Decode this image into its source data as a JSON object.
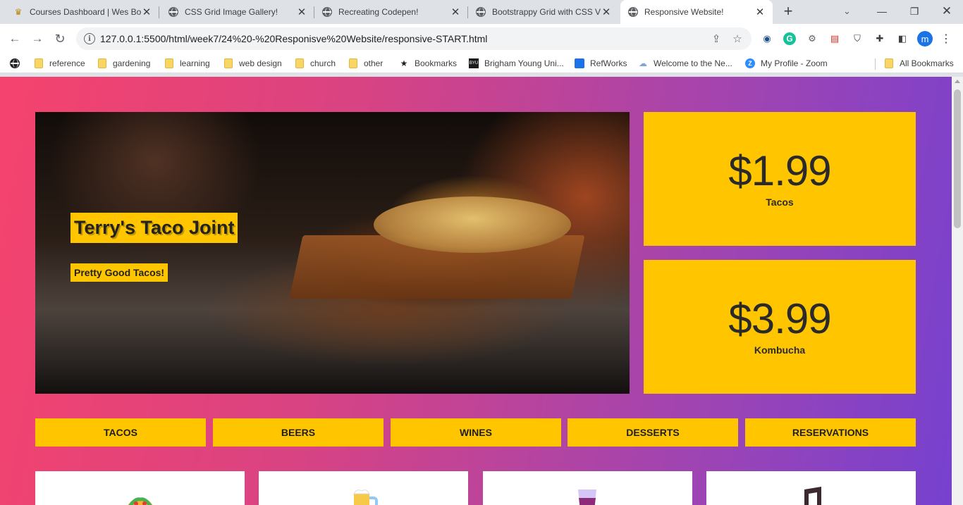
{
  "browser": {
    "tabs": [
      {
        "title": "Courses Dashboard | Wes Bo",
        "icon": "crown-icon",
        "active": false
      },
      {
        "title": "CSS Grid Image Gallery!",
        "icon": "globe-icon",
        "active": false
      },
      {
        "title": "Recreating Codepen!",
        "icon": "globe-icon",
        "active": false
      },
      {
        "title": "Bootstrappy Grid with CSS V",
        "icon": "globe-icon",
        "active": false
      },
      {
        "title": "Responsive Website!",
        "icon": "globe-icon",
        "active": true
      }
    ],
    "url": "127.0.0.1:5500/html/week7/24%20-%20Responisve%20Website/responsive-START.html",
    "profile_initial": "m",
    "bookmarks": [
      {
        "label": "",
        "icon": "globe-icon"
      },
      {
        "label": "reference",
        "icon": "folder-icon"
      },
      {
        "label": "gardening",
        "icon": "folder-icon"
      },
      {
        "label": "learning",
        "icon": "folder-icon"
      },
      {
        "label": "web design",
        "icon": "folder-icon"
      },
      {
        "label": "church",
        "icon": "folder-icon"
      },
      {
        "label": "other",
        "icon": "folder-icon"
      },
      {
        "label": "Bookmarks",
        "icon": "star-icon"
      },
      {
        "label": "Brigham Young Uni...",
        "icon": "byu-icon"
      },
      {
        "label": "RefWorks",
        "icon": "refworks-icon"
      },
      {
        "label": "Welcome to the Ne...",
        "icon": "cloud-icon"
      },
      {
        "label": "My Profile - Zoom",
        "icon": "zoom-icon"
      }
    ],
    "all_bookmarks": "All Bookmarks"
  },
  "page": {
    "hero": {
      "title": "Terry's Taco Joint",
      "subtitle": "Pretty Good Tacos!"
    },
    "prices": [
      {
        "amount": "$1.99",
        "label": "Tacos"
      },
      {
        "amount": "$3.99",
        "label": "Kombucha"
      }
    ],
    "menu": [
      "Tacos",
      "Beers",
      "Wines",
      "Desserts",
      "Reservations"
    ],
    "features": [
      {
        "icon": "taco-icon"
      },
      {
        "icon": "beer-mug-icon"
      },
      {
        "icon": "wine-glass-icon"
      },
      {
        "icon": "music-note-icon"
      }
    ],
    "colors": {
      "accent": "#ffc600",
      "gradient_start": "#f5436d",
      "gradient_end": "#7641cf"
    }
  }
}
